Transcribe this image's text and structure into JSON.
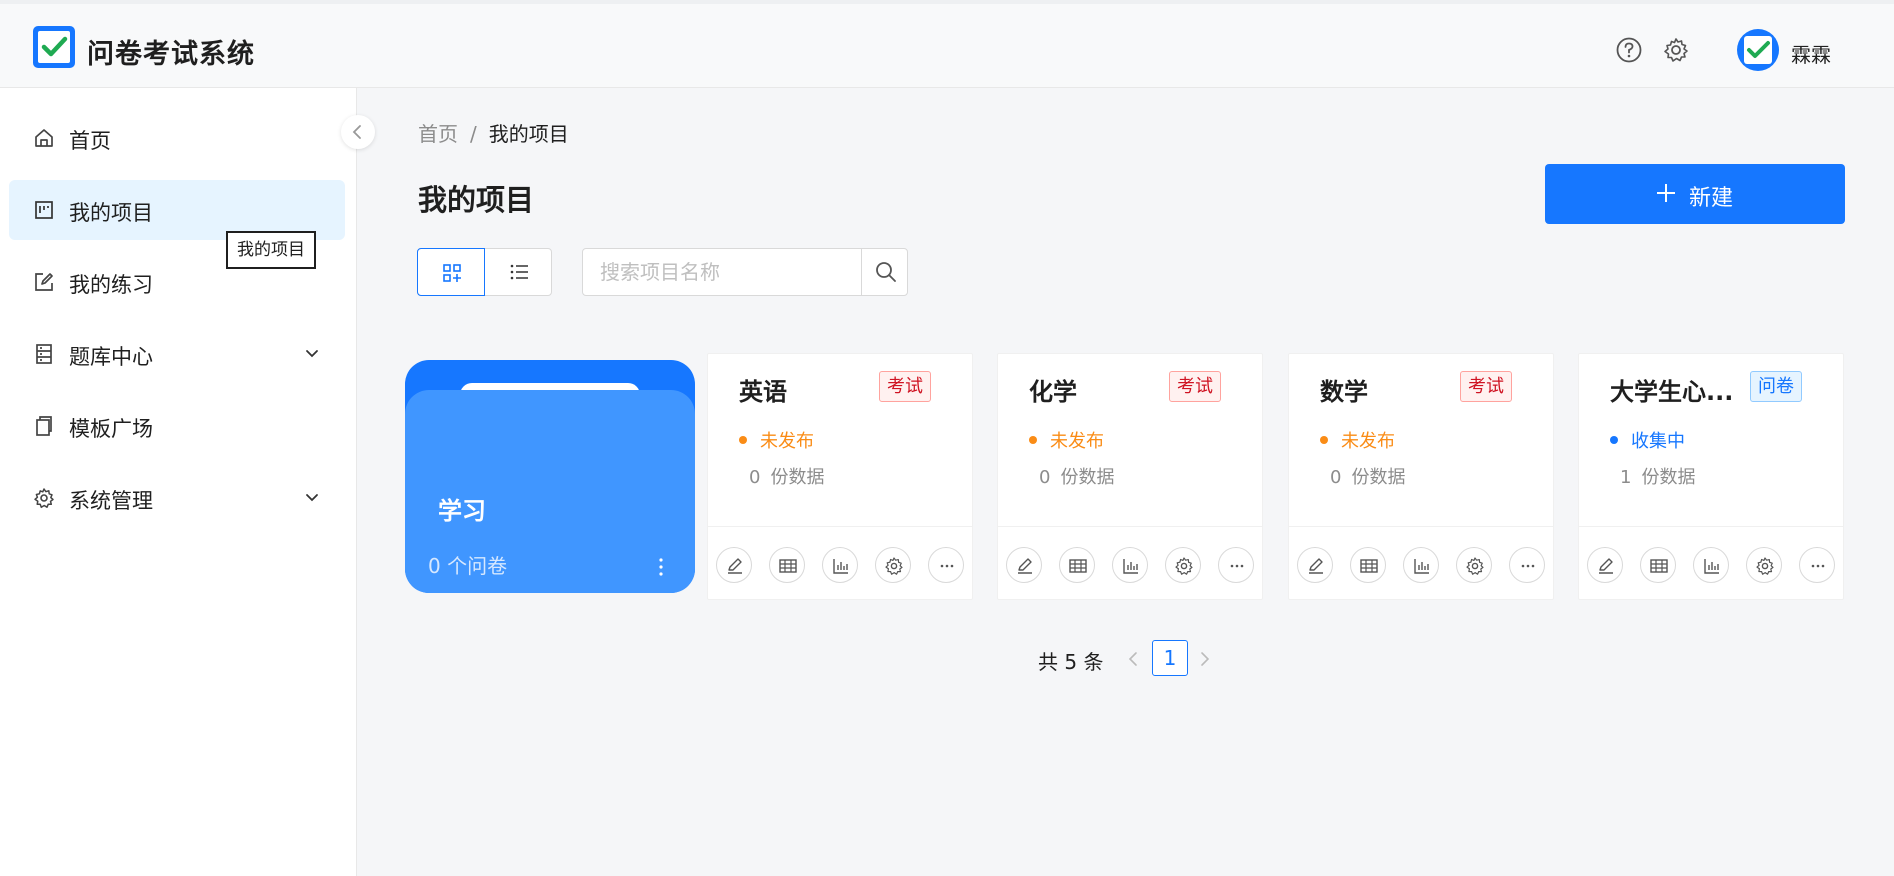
{
  "app": {
    "title": "问卷考试系统"
  },
  "header": {
    "username": "霖霖",
    "help_icon": "question-circle-icon",
    "settings_icon": "gear-icon"
  },
  "sidebar": {
    "items": [
      {
        "label": "首页",
        "icon": "home-icon"
      },
      {
        "label": "我的项目",
        "icon": "project-icon",
        "active": true
      },
      {
        "label": "我的练习",
        "icon": "edit-icon"
      },
      {
        "label": "题库中心",
        "icon": "database-icon",
        "expandable": true
      },
      {
        "label": "模板广场",
        "icon": "copy-icon"
      },
      {
        "label": "系统管理",
        "icon": "gear-icon",
        "expandable": true
      }
    ],
    "tooltip": "我的项目"
  },
  "breadcrumb": {
    "home": "首页",
    "sep": "/",
    "current": "我的项目"
  },
  "page": {
    "title": "我的项目",
    "new_label": "新建"
  },
  "search": {
    "placeholder": "搜索项目名称"
  },
  "folder": {
    "title": "学习",
    "count": "0 个问卷"
  },
  "cards": [
    {
      "title": "英语",
      "tag": "考试",
      "status": "未发布",
      "count": "0",
      "count_label": "份数据"
    },
    {
      "title": "化学",
      "tag": "考试",
      "status": "未发布",
      "count": "0",
      "count_label": "份数据"
    },
    {
      "title": "数学",
      "tag": "考试",
      "status": "未发布",
      "count": "0",
      "count_label": "份数据"
    },
    {
      "title": "大学生心...",
      "tag": "问卷",
      "status": "收集中",
      "count": "1",
      "count_label": "份数据"
    }
  ],
  "pagination": {
    "total": "共 5 条",
    "current": "1"
  },
  "colors": {
    "primary": "#1677ff",
    "folder_front": "#4096ff",
    "exam_tag": "#cf1322",
    "unpublished": "#fa8c16"
  }
}
